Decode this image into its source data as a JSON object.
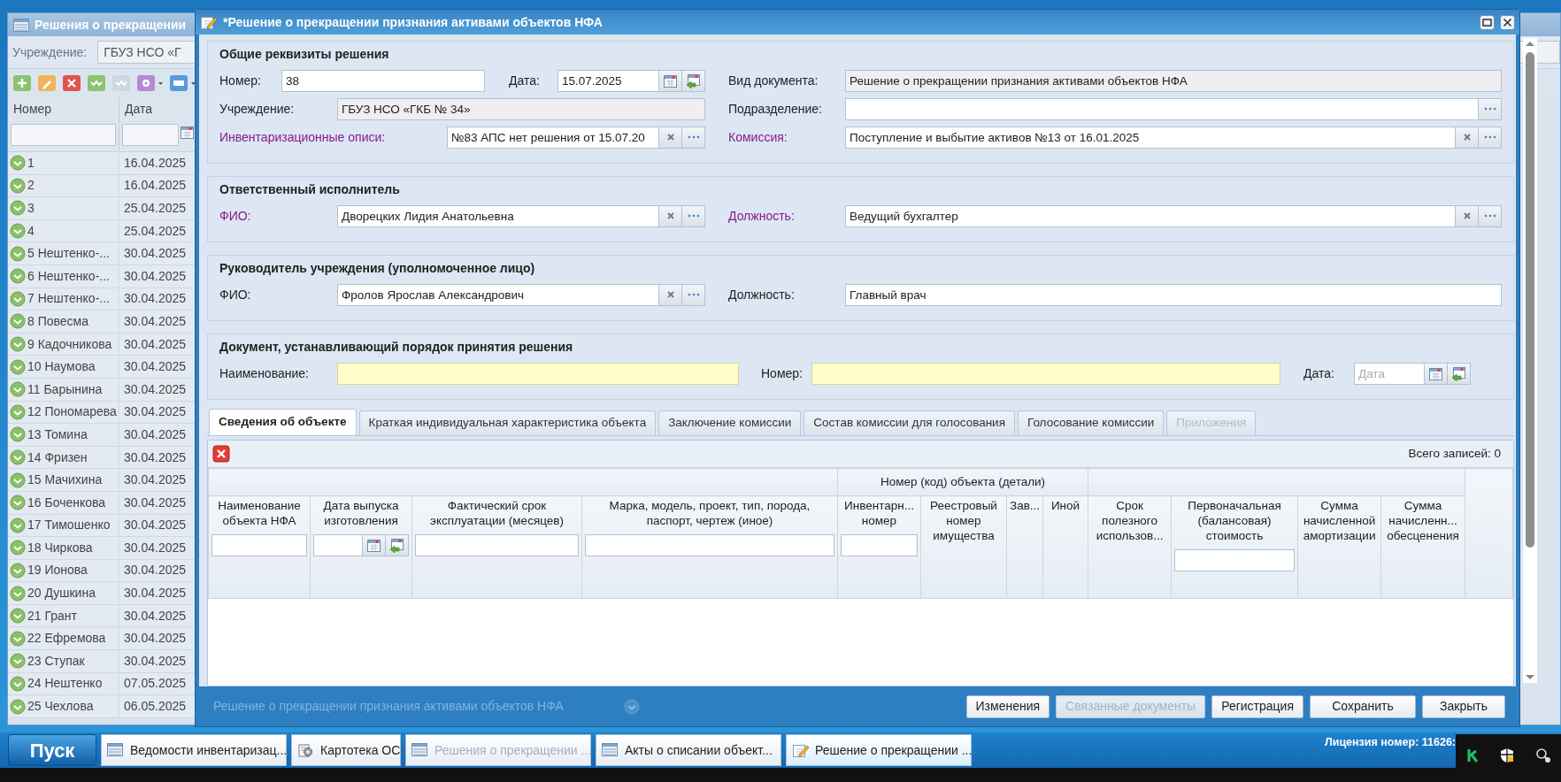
{
  "background_window": {
    "title": "Решения о прекращении",
    "filter_label": "Учреждение:",
    "filter_value": "ГБУЗ НСО «Г",
    "columns": [
      "Номер",
      "Дата"
    ],
    "rows": [
      {
        "number": "1",
        "date": "16.04.2025"
      },
      {
        "number": "2",
        "date": "16.04.2025"
      },
      {
        "number": "3",
        "date": "25.04.2025"
      },
      {
        "number": "4",
        "date": "25.04.2025"
      },
      {
        "number": "5 Нештенко-...",
        "date": "30.04.2025"
      },
      {
        "number": "6 Нештенко-...",
        "date": "30.04.2025"
      },
      {
        "number": "7 Нештенко-...",
        "date": "30.04.2025"
      },
      {
        "number": "8 Повесма",
        "date": "30.04.2025"
      },
      {
        "number": "9 Кадочникова",
        "date": "30.04.2025"
      },
      {
        "number": "10 Наумова",
        "date": "30.04.2025"
      },
      {
        "number": "11 Барынина",
        "date": "30.04.2025"
      },
      {
        "number": "12 Пономарева",
        "date": "30.04.2025"
      },
      {
        "number": "13 Томина",
        "date": "30.04.2025"
      },
      {
        "number": "14 Фризен",
        "date": "30.04.2025"
      },
      {
        "number": "15 Мачихина",
        "date": "30.04.2025"
      },
      {
        "number": "16 Боченкова",
        "date": "30.04.2025"
      },
      {
        "number": "17 Тимошенко",
        "date": "30.04.2025"
      },
      {
        "number": "18 Чиркова",
        "date": "30.04.2025"
      },
      {
        "number": "19 Ионова",
        "date": "30.04.2025"
      },
      {
        "number": "20 Душкина",
        "date": "30.04.2025"
      },
      {
        "number": "21 Грант",
        "date": "30.04.2025"
      },
      {
        "number": "22 Ефремова",
        "date": "30.04.2025"
      },
      {
        "number": "23 Ступак",
        "date": "30.04.2025"
      },
      {
        "number": "24 Нештенко",
        "date": "07.05.2025"
      },
      {
        "number": "25 Чехлова",
        "date": "06.05.2025"
      }
    ],
    "behind_dialog_rows": [
      "Решение о прекращении признания активами объектов НФА"
    ]
  },
  "dialog": {
    "title": "*Решение о прекращении признания активами объектов НФА",
    "sections": [
      {
        "title": "Общие реквизиты решения",
        "rows": [
          [
            {
              "label": "Номер:",
              "kind": "text",
              "value": "38",
              "required": false
            },
            {
              "label": "Дата:",
              "kind": "date",
              "value": "15.07.2025",
              "required": false
            },
            {
              "label": "Вид документа:",
              "kind": "readonly",
              "value": "Решение о прекращении признания активами объектов НФА",
              "required": false
            }
          ],
          [
            {
              "label": "Учреждение:",
              "kind": "readonly",
              "value": "ГБУЗ НСО «ГКБ № 34»",
              "required": false
            },
            {
              "label": "Подразделение:",
              "kind": "browse",
              "required": false
            }
          ],
          [
            {
              "label": "Инвентаризационные описи:",
              "kind": "lookup",
              "value": "№83 АПС нет решения от 15.07.20",
              "required": true
            },
            {
              "label": "Комиссия:",
              "kind": "lookup",
              "value": "Поступление и выбытие активов №13 от 16.01.2025",
              "required": true
            }
          ]
        ]
      },
      {
        "title": "Ответственный исполнитель",
        "rows": [
          [
            {
              "label": "ФИО:",
              "kind": "lookup",
              "value": "Дворецких Лидия Анатольевна",
              "required": true
            },
            {
              "label": "Должность:",
              "kind": "lookup",
              "value": "Ведущий бухгалтер",
              "required": true
            }
          ]
        ]
      },
      {
        "title": "Руководитель учреждения (уполномоченное лицо)",
        "rows": [
          [
            {
              "label": "ФИО:",
              "kind": "lookup",
              "value": "Фролов Ярослав Александрович",
              "required": false
            },
            {
              "label": "Должность:",
              "kind": "text",
              "value": "Главный врач",
              "required": false
            }
          ]
        ]
      },
      {
        "title": "Документ, устанавливающий порядок принятия решения",
        "rows": [
          [
            {
              "label": "Наименование:",
              "kind": "text",
              "required": false,
              "highlighted": true
            },
            {
              "label": "Номер:",
              "kind": "text",
              "required": false,
              "highlighted": true
            },
            {
              "label": "Дата:",
              "kind": "date",
              "placeholder": "Дата",
              "required": false,
              "highlighted": false
            }
          ]
        ]
      }
    ],
    "tabs": [
      {
        "label": "Сведения об объекте",
        "selected": true,
        "disabled": false
      },
      {
        "label": "Краткая индивидуальная характеристика объекта",
        "selected": false,
        "disabled": false
      },
      {
        "label": "Заключение комиссии",
        "selected": false,
        "disabled": false
      },
      {
        "label": "Состав комиссии для голосования",
        "selected": false,
        "disabled": false
      },
      {
        "label": "Голосование комиссии",
        "selected": false,
        "disabled": false
      },
      {
        "label": "Приложения",
        "selected": false,
        "disabled": true
      }
    ],
    "grid": {
      "total": "Всего записей: 0",
      "column_groups": [
        {
          "columns": [
            {
              "label": "Наименование объекта НФА",
              "kind": "text"
            },
            {
              "label": "Дата выпуска изготовления",
              "kind": "date"
            },
            {
              "label": "Фактический срок эксплуатации (месяцев)",
              "kind": "text"
            },
            {
              "label": "Марка, модель, проект, тип, порода, паспорт, чертеж (иное)",
              "kind": "text"
            }
          ]
        },
        {
          "label": "Номер (код) объекта (детали)",
          "columns": [
            {
              "label": "Инвентарн... номер",
              "kind": "text"
            },
            {
              "label": "Реестровый номер имущества",
              "kind": "plain"
            },
            {
              "label": "Зав...",
              "kind": "plain"
            },
            {
              "label": "Иной",
              "kind": "plain"
            }
          ]
        },
        {
          "columns": [
            {
              "label": "Срок полезного использов...",
              "kind": "plain"
            },
            {
              "label": "Первоначальная (балансовая) стоимость",
              "kind": "text"
            },
            {
              "label": "Сумма начисленной амортизации",
              "kind": "plain"
            },
            {
              "label": "Сумма начисленн... обесценения",
              "kind": "plain"
            }
          ]
        }
      ]
    },
    "buttons": [
      {
        "label": "Изменения",
        "disabled": false
      },
      {
        "label": "Связанные документы",
        "disabled": true
      },
      {
        "label": "Регистрация",
        "disabled": false
      },
      {
        "label": "Сохранить",
        "disabled": false
      },
      {
        "label": "Закрыть",
        "disabled": false
      }
    ]
  },
  "taskbar": {
    "start": "Пуск",
    "items": [
      {
        "label": "Ведомости инвентаризац...",
        "kind": "list",
        "selected": false,
        "dimmed": false
      },
      {
        "label": "Картотека ОС",
        "kind": "catalog",
        "selected": false,
        "dimmed": false
      },
      {
        "label": "Решения о прекращении ...",
        "kind": "list",
        "selected": false,
        "dimmed": true
      },
      {
        "label": "Акты о списании объект...",
        "kind": "list",
        "selected": false,
        "dimmed": false
      },
      {
        "label": "Решение о прекращении ...",
        "kind": "editor",
        "selected": true,
        "dimmed": false
      }
    ],
    "license": "Лицензия номер: 11626:"
  }
}
